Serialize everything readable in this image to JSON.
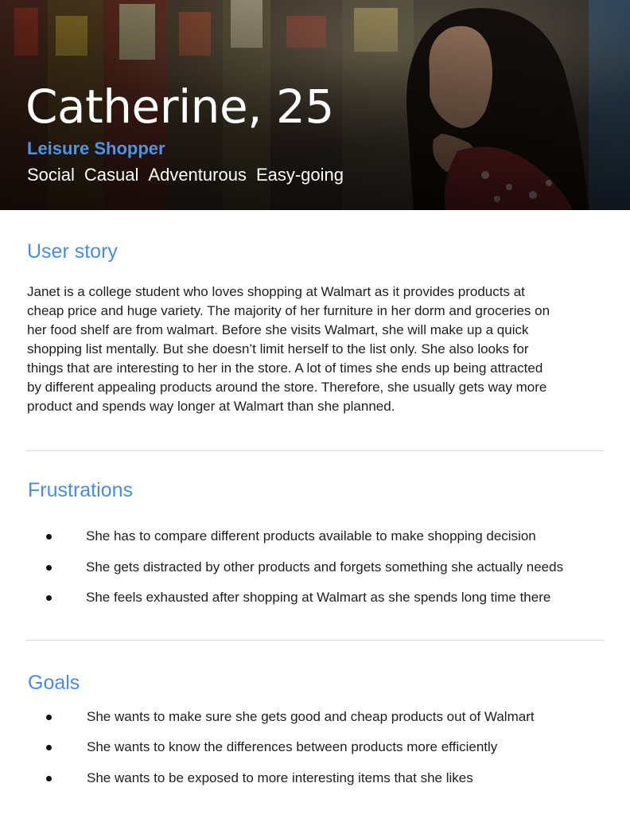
{
  "persona": {
    "name": "Catherine, 25",
    "role": "Leisure Shopper",
    "traits": [
      "Social",
      "Casual",
      "Adventurous",
      "Easy-going"
    ]
  },
  "user_story": {
    "heading": "User story",
    "lines": [
      "Janet is a college student who loves shopping at Walmart as it provides products at",
      "cheap price and huge variety. The majority of her furniture in her dorm and groceries on",
      "her food shelf are from walmart. Before she visits Walmart, she will make up a quick",
      "shopping list mentally. But she doesn’t limit herself to the list only. She also looks for",
      "things that are interesting to her in the store.  A lot of times she ends up being attracted",
      "by different appealing products around the store. Therefore, she usually gets way more",
      "product and spends way longer at Walmart than she planned."
    ]
  },
  "frustrations": {
    "heading": "Frustrations",
    "items": [
      "She has to compare different products available to make shopping decision",
      "She gets distracted by other products and forgets something she actually needs",
      "She feels exhausted after shopping at Walmart as she spends long time there"
    ]
  },
  "goals": {
    "heading": "Goals",
    "items": [
      "She wants to make sure she gets good and cheap products out of Walmart",
      "She wants to know the differences between products more efficiently",
      "She wants to be exposed to more interesting items that she likes"
    ]
  },
  "colors": {
    "accent_blue": "#4a8dd8",
    "role_blue": "#4e93e6",
    "body_text": "#1e1e1e",
    "divider": "#d6d6d6"
  }
}
